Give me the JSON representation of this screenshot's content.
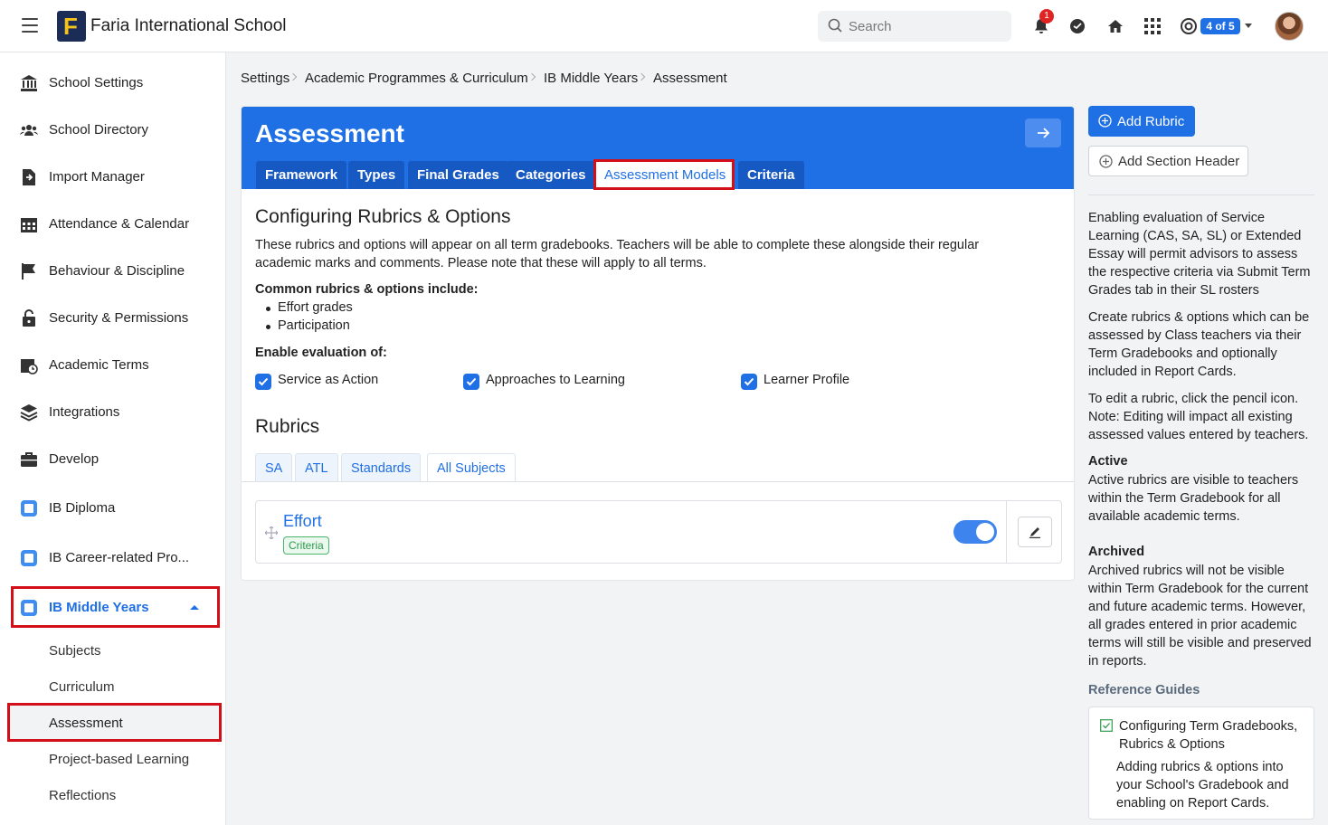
{
  "app": {
    "school_name": "Faria International School",
    "logo_letter": "F"
  },
  "topbar": {
    "search_placeholder": "Search",
    "notification_count": "1",
    "pagination": "4 of 5"
  },
  "sidebar": {
    "items": [
      {
        "label": "School Settings",
        "icon": "bank-icon"
      },
      {
        "label": "School Directory",
        "icon": "users-icon"
      },
      {
        "label": "Import Manager",
        "icon": "file-import-icon"
      },
      {
        "label": "Attendance & Calendar",
        "icon": "calendar-icon"
      },
      {
        "label": "Behaviour & Discipline",
        "icon": "flag-icon"
      },
      {
        "label": "Security & Permissions",
        "icon": "lock-icon"
      },
      {
        "label": "Academic Terms",
        "icon": "calendar-clock-icon"
      },
      {
        "label": "Integrations",
        "icon": "layers-icon"
      },
      {
        "label": "Develop",
        "icon": "briefcase-icon"
      },
      {
        "label": "IB Diploma",
        "icon": "ib-dp-icon"
      },
      {
        "label": "IB Career-related Pro...",
        "icon": "ib-cp-icon"
      },
      {
        "label": "IB Middle Years",
        "icon": "ib-myp-icon"
      }
    ],
    "sub_items": [
      "Subjects",
      "Curriculum",
      "Assessment",
      "Project-based Learning",
      "Reflections"
    ]
  },
  "breadcrumb": [
    "Settings",
    "Academic Programmes & Curriculum",
    "IB Middle Years",
    "Assessment"
  ],
  "page": {
    "title": "Assessment",
    "tabs": [
      "Framework",
      "Types",
      "Final Grades",
      "Categories",
      "Assessment Models",
      "Criteria"
    ],
    "active_tab": "Assessment Models",
    "section_title": "Configuring Rubrics & Options",
    "description": "These rubrics and options will appear on all term gradebooks. Teachers will be able to complete these alongside their regular academic marks and comments. Please note that these will apply to all terms.",
    "common_label": "Common rubrics & options include:",
    "common_items": [
      "Effort grades",
      "Participation"
    ],
    "enable_label": "Enable evaluation of:",
    "checkboxes": [
      {
        "label": "Service as Action",
        "checked": true
      },
      {
        "label": "Approaches to Learning",
        "checked": true
      },
      {
        "label": "Learner Profile",
        "checked": true
      }
    ],
    "rubrics_title": "Rubrics",
    "rubric_tabs": [
      "SA",
      "ATL",
      "Standards",
      "All Subjects"
    ],
    "active_rubric_tab": "All Subjects",
    "rubric": {
      "name": "Effort",
      "tag": "Criteria",
      "active": true
    }
  },
  "right_panel": {
    "add_rubric": "Add Rubric",
    "add_section_header": "Add Section Header",
    "p1": "Enabling evaluation of Service Learning (CAS, SA, SL) or Extended Essay will permit advisors to assess the respective criteria via Submit Term Grades tab in their SL rosters",
    "p2": "Create rubrics & options which can be assessed by Class teachers via their Term Gradebooks and optionally included in Report Cards.",
    "p3": "To edit a rubric, click the pencil icon. Note: Editing will impact all existing assessed values entered by teachers.",
    "active_heading": "Active",
    "active_text": "Active rubrics are visible to teachers within the Term Gradebook for all available academic terms.",
    "archived_heading": "Archived",
    "archived_text": "Archived rubrics will not be visible within Term Gradebook for the current and future academic terms. However, all grades entered in prior academic terms will still be visible and preserved in reports.",
    "reference_heading": "Reference Guides",
    "guide_title": "Configuring Term Gradebooks, Rubrics & Options",
    "guide_desc": "Adding rubrics & options into your School's Gradebook and enabling on Report Cards."
  },
  "colors": {
    "primary": "#1f6fe5",
    "highlight": "#d3101a",
    "tag_green": "#2d9b4e"
  }
}
